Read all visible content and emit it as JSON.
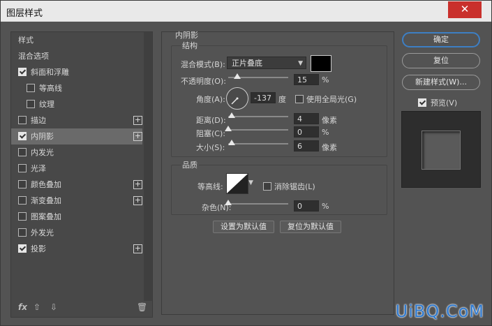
{
  "window": {
    "title": "图层样式",
    "close": "✕"
  },
  "left": {
    "items": [
      {
        "label": "样式",
        "checkbox": null,
        "plus": false,
        "indent": 0
      },
      {
        "label": "混合选项",
        "checkbox": null,
        "plus": false,
        "indent": 0
      },
      {
        "label": "斜面和浮雕",
        "checkbox": true,
        "plus": false,
        "indent": 0
      },
      {
        "label": "等高线",
        "checkbox": false,
        "plus": false,
        "indent": 1
      },
      {
        "label": "纹理",
        "checkbox": false,
        "plus": false,
        "indent": 1
      },
      {
        "label": "描边",
        "checkbox": false,
        "plus": true,
        "indent": 0
      },
      {
        "label": "内阴影",
        "checkbox": true,
        "plus": true,
        "indent": 0,
        "selected": true
      },
      {
        "label": "内发光",
        "checkbox": false,
        "plus": false,
        "indent": 0
      },
      {
        "label": "光泽",
        "checkbox": false,
        "plus": false,
        "indent": 0
      },
      {
        "label": "颜色叠加",
        "checkbox": false,
        "plus": true,
        "indent": 0
      },
      {
        "label": "渐变叠加",
        "checkbox": false,
        "plus": true,
        "indent": 0
      },
      {
        "label": "图案叠加",
        "checkbox": false,
        "plus": false,
        "indent": 0
      },
      {
        "label": "外发光",
        "checkbox": false,
        "plus": false,
        "indent": 0
      },
      {
        "label": "投影",
        "checkbox": true,
        "plus": true,
        "indent": 0
      }
    ],
    "bottom": {
      "fx": "fx",
      "up": "⇧",
      "down": "⇩",
      "trash": "🗑"
    }
  },
  "panel": {
    "section": "内阴影",
    "structure": "结构",
    "blend_mode_label": "混合模式(B):",
    "blend_mode_value": "正片叠底",
    "opacity_label": "不透明度(O):",
    "opacity_value": "15",
    "opacity_unit": "%",
    "opacity_fraction": 0.15,
    "angle_label": "角度(A):",
    "angle_value": "-137",
    "angle_unit": "度",
    "global_light_label": "使用全局光(G)",
    "global_light": false,
    "distance_label": "距离(D):",
    "distance_value": "4",
    "distance_unit": "像素",
    "choke_label": "阻塞(C):",
    "choke_value": "0",
    "choke_unit": "%",
    "size_label": "大小(S):",
    "size_value": "6",
    "size_unit": "像素",
    "quality": "品质",
    "contour_label": "等高线:",
    "antialias_label": "消除锯齿(L)",
    "antialias": false,
    "noise_label": "杂色(N):",
    "noise_value": "0",
    "noise_unit": "%",
    "set_default": "设置为默认值",
    "reset_default": "复位为默认值",
    "shadow_color": "#000000"
  },
  "right": {
    "ok": "确定",
    "reset": "复位",
    "new_style": "新建样式(W)...",
    "preview_label": "预览(V)",
    "preview": true
  },
  "watermark": "UiBQ.CoM"
}
